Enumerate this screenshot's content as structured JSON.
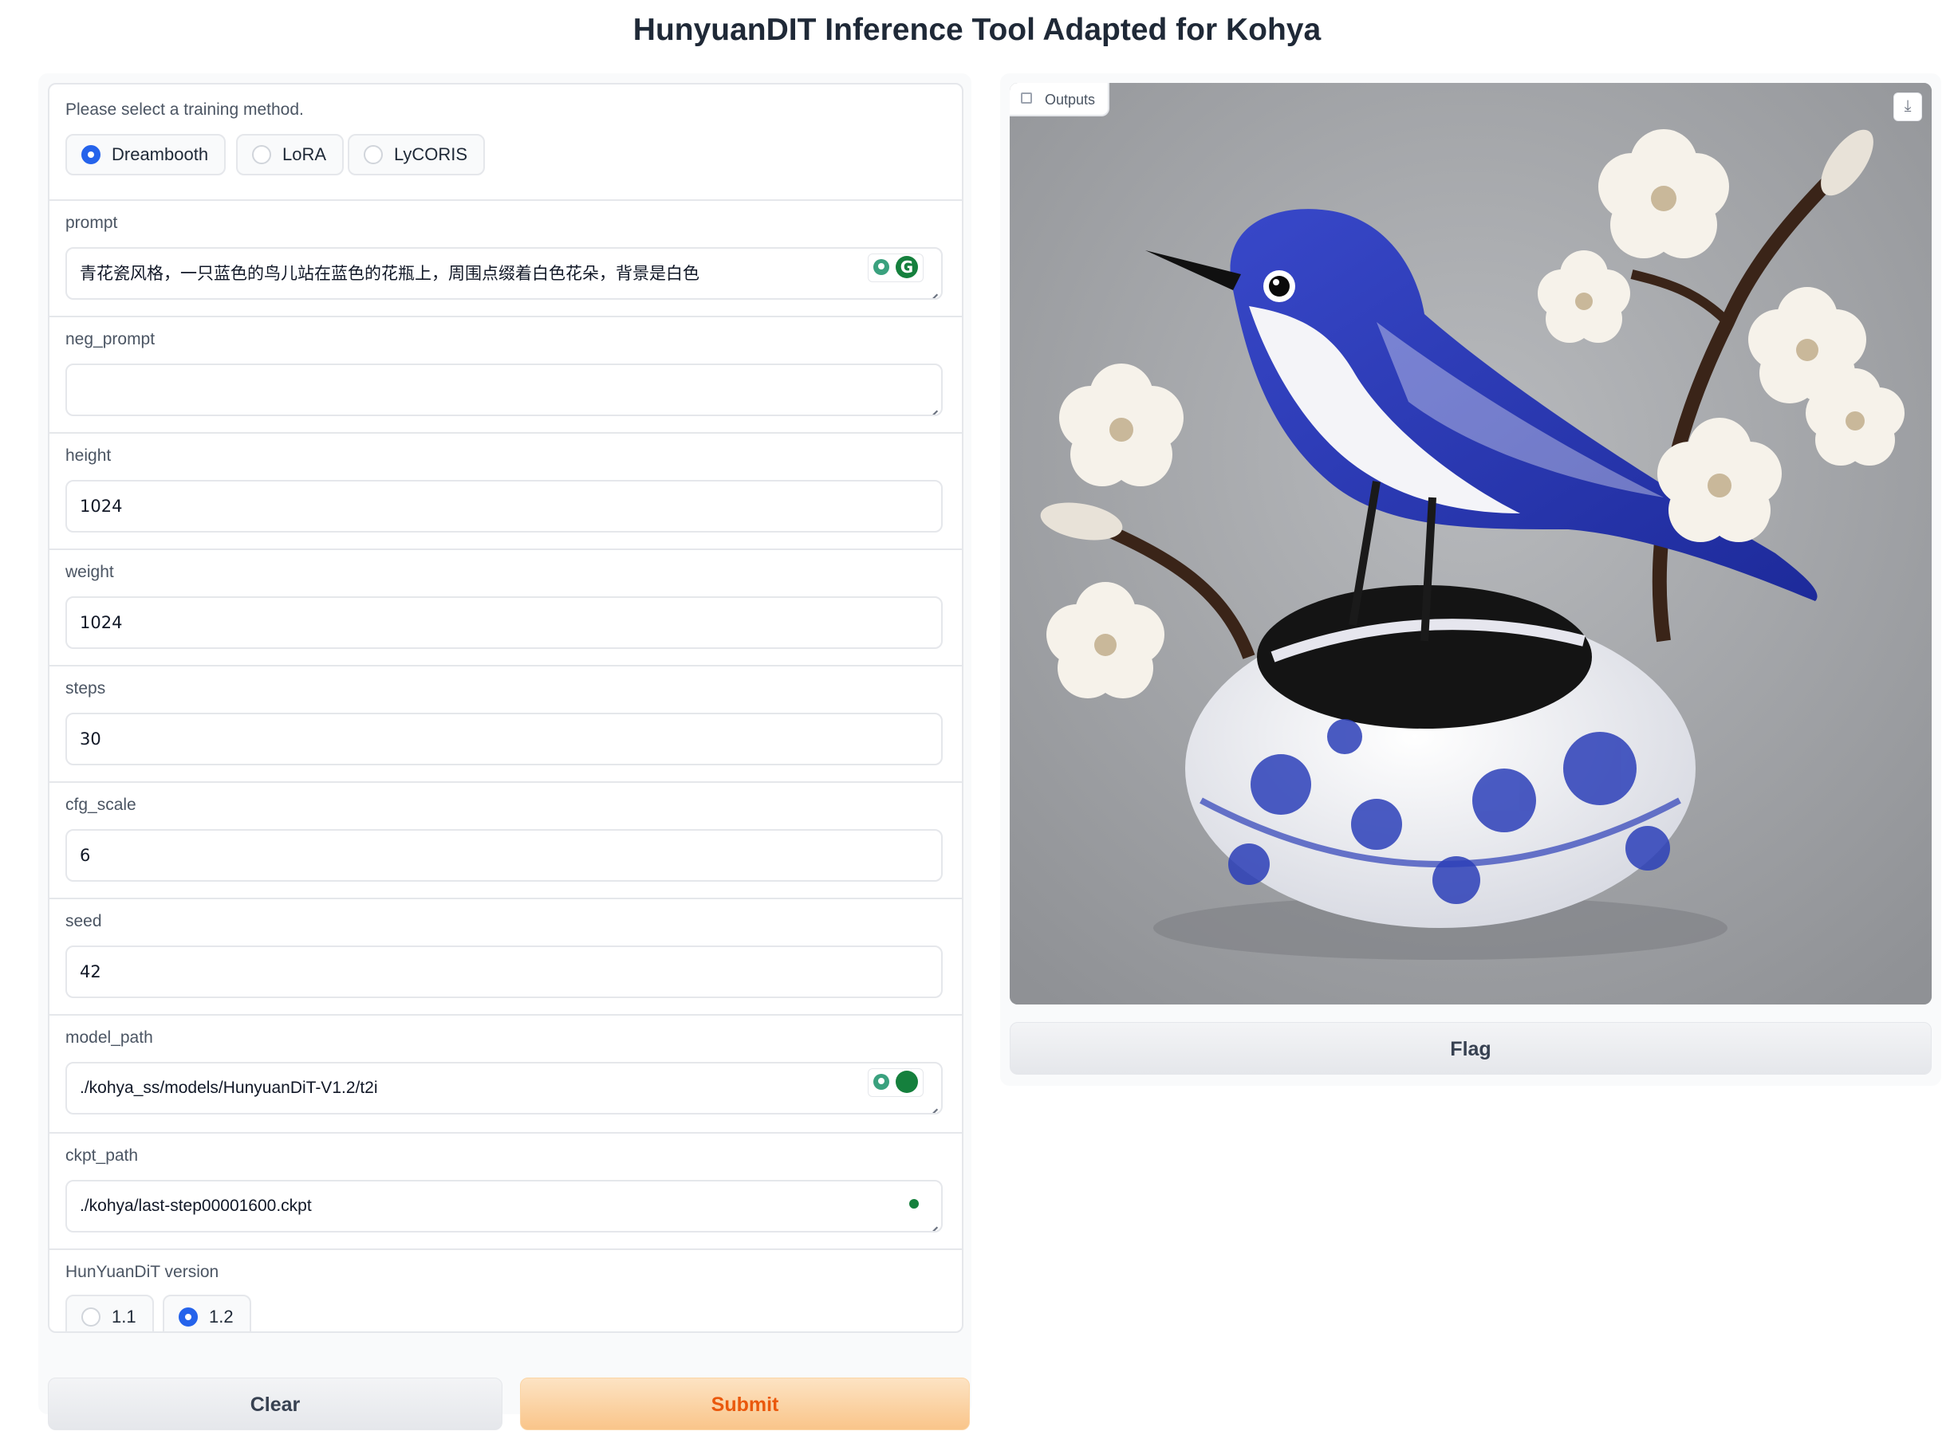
{
  "title": "HunyuanDIT Inference Tool Adapted for Kohya",
  "training_method": {
    "label": "Please select a training method.",
    "options": [
      "Dreambooth",
      "LoRA",
      "LyCORIS"
    ],
    "selected": "Dreambooth"
  },
  "fields": {
    "prompt": {
      "label": "prompt",
      "value": "青花瓷风格，一只蓝色的鸟儿站在蓝色的花瓶上，周围点缀着白色花朵，背景是白色"
    },
    "neg_prompt": {
      "label": "neg_prompt",
      "value": ""
    },
    "height": {
      "label": "height",
      "value": "1024"
    },
    "weight": {
      "label": "weight",
      "value": "1024"
    },
    "steps": {
      "label": "steps",
      "value": "30"
    },
    "cfg_scale": {
      "label": "cfg_scale",
      "value": "6"
    },
    "seed": {
      "label": "seed",
      "value": "42"
    },
    "model_path": {
      "label": "model_path",
      "value": "./kohya_ss/models/HunyuanDiT-V1.2/t2i"
    },
    "ckpt_path": {
      "label": "ckpt_path",
      "value": "./kohya/last-step00001600.ckpt"
    }
  },
  "version": {
    "label": "HunYuanDiT version",
    "options": [
      "1.1",
      "1.2"
    ],
    "selected": "1.2"
  },
  "buttons": {
    "clear": "Clear",
    "submit": "Submit",
    "flag": "Flag"
  },
  "output": {
    "tab_label": "Outputs",
    "download_icon": "download-icon"
  },
  "colors": {
    "accent": "#2563eb",
    "submit_text": "#ea580c",
    "submit_bg": "#f9c58a",
    "extension_green": "#15803d"
  }
}
